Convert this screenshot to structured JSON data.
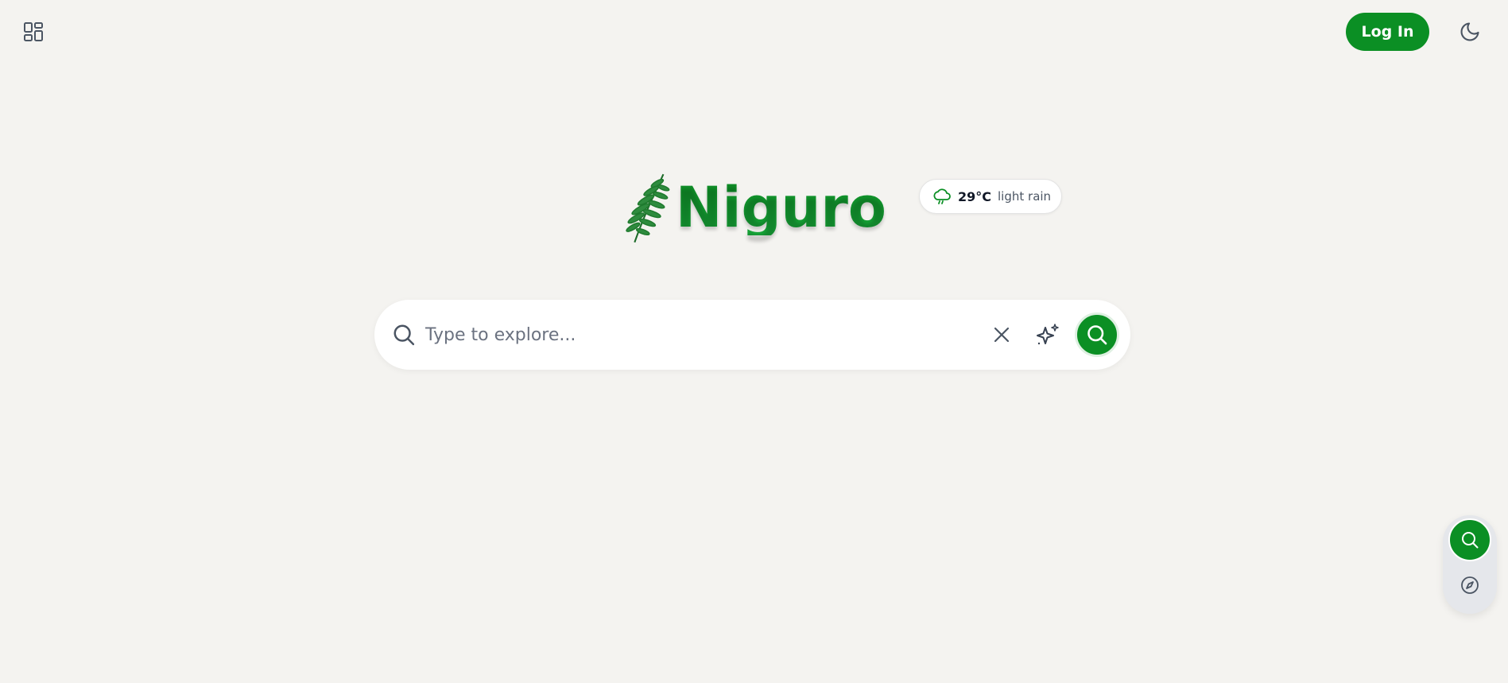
{
  "header": {
    "apps_icon": "apps-grid-icon",
    "login_label": "Log In",
    "theme_icon": "moon-icon"
  },
  "brand": {
    "name": "Niguro",
    "logo_icon": "fern-leaf-icon",
    "color": "#0b8f24"
  },
  "weather": {
    "icon": "cloud-rain-icon",
    "temperature": "29°C",
    "description": "light rain"
  },
  "search": {
    "placeholder": "Type to explore...",
    "value": "",
    "search_icon": "search-icon",
    "clear_icon": "close-icon",
    "ai_icon": "sparkles-icon",
    "submit_icon": "search-icon"
  },
  "dock": {
    "search_icon": "search-icon",
    "explore_icon": "compass-icon"
  }
}
